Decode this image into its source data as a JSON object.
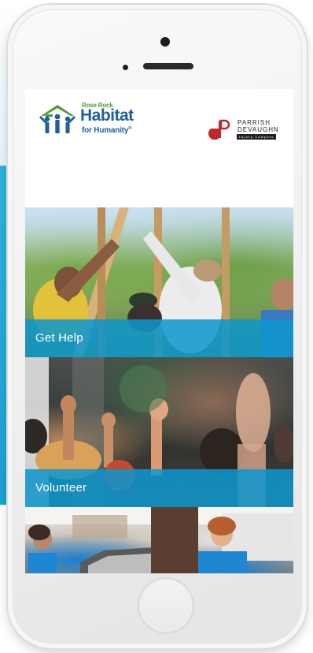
{
  "header": {
    "habitat_logo": {
      "small_text": "Rose Rock",
      "big_text": "Habitat",
      "sub_text": "for Humanity",
      "reg_mark": "®"
    },
    "sponsor_logo": {
      "line1": "PARRISH",
      "line2": "DEVAUGHN",
      "tagline": "Injury Lawyers"
    }
  },
  "tiles": [
    {
      "label": "Get Help",
      "image": "volunteers-building-frame-photo"
    },
    {
      "label": "Volunteer",
      "image": "raised-hands-photo"
    },
    {
      "label": "",
      "image": "volunteers-outdoor-photo"
    }
  ],
  "colors": {
    "accent_blue": "#0e96cd",
    "habitat_blue": "#1f5f9e",
    "habitat_green": "#4a9a37",
    "sponsor_red": "#c0272d"
  }
}
